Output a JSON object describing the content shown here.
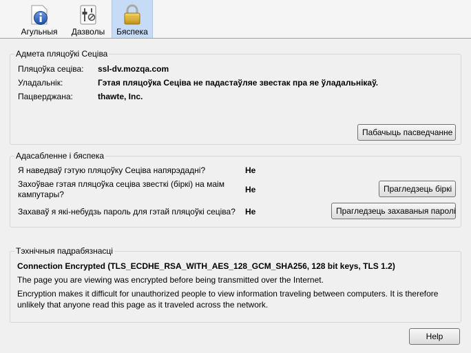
{
  "tabs": [
    {
      "label": "Агульныя",
      "icon": "info-icon"
    },
    {
      "label": "Дазволы",
      "icon": "permissions-icon"
    },
    {
      "label": "Бяспека",
      "icon": "lock-icon",
      "selected": true
    }
  ],
  "identity": {
    "title": "Адмета пляцоўкі Сеціва",
    "website_label": "Пляцоўка сеціва:",
    "website_value": "ssl-dv.mozqa.com",
    "owner_label": "Уладальнік:",
    "owner_value": "Гэтая пляцоўка Сеціва не падастаўляе звестак пра яе ўладальнікаў.",
    "verified_label": "Пацверджана:",
    "verified_value": "thawte, Inc.",
    "view_cert_button": "Пабачыць пасведчанне"
  },
  "privacy": {
    "title": "Адасабленне і бяспека",
    "visited_label": "Я наведваў гэтую пляцоўку Сеціва напярэдадні?",
    "visited_value": "Не",
    "cookies_label": "Захоўвае гэтая пляцоўка сеціва звесткі (біркі) на маім кампутары?",
    "cookies_value": "Не",
    "cookies_button": "Прагледзець біркі",
    "passwords_label": "Захаваў я які-небудзь пароль для гэтай пляцоўкі сеціва?",
    "passwords_value": "Не",
    "passwords_button": "Прагледзець захаваныя паролі"
  },
  "technical": {
    "title": "Тэхнічныя падрабязнасці",
    "connection": "Connection Encrypted (TLS_ECDHE_RSA_WITH_AES_128_GCM_SHA256, 128 bit keys, TLS 1.2)",
    "line1": "The page you are viewing was encrypted before being transmitted over the Internet.",
    "line2": "Encryption makes it difficult for unauthorized people to view information traveling between computers. It is therefore unlikely that anyone read this page as it traveled across the network."
  },
  "help_button": "Help"
}
